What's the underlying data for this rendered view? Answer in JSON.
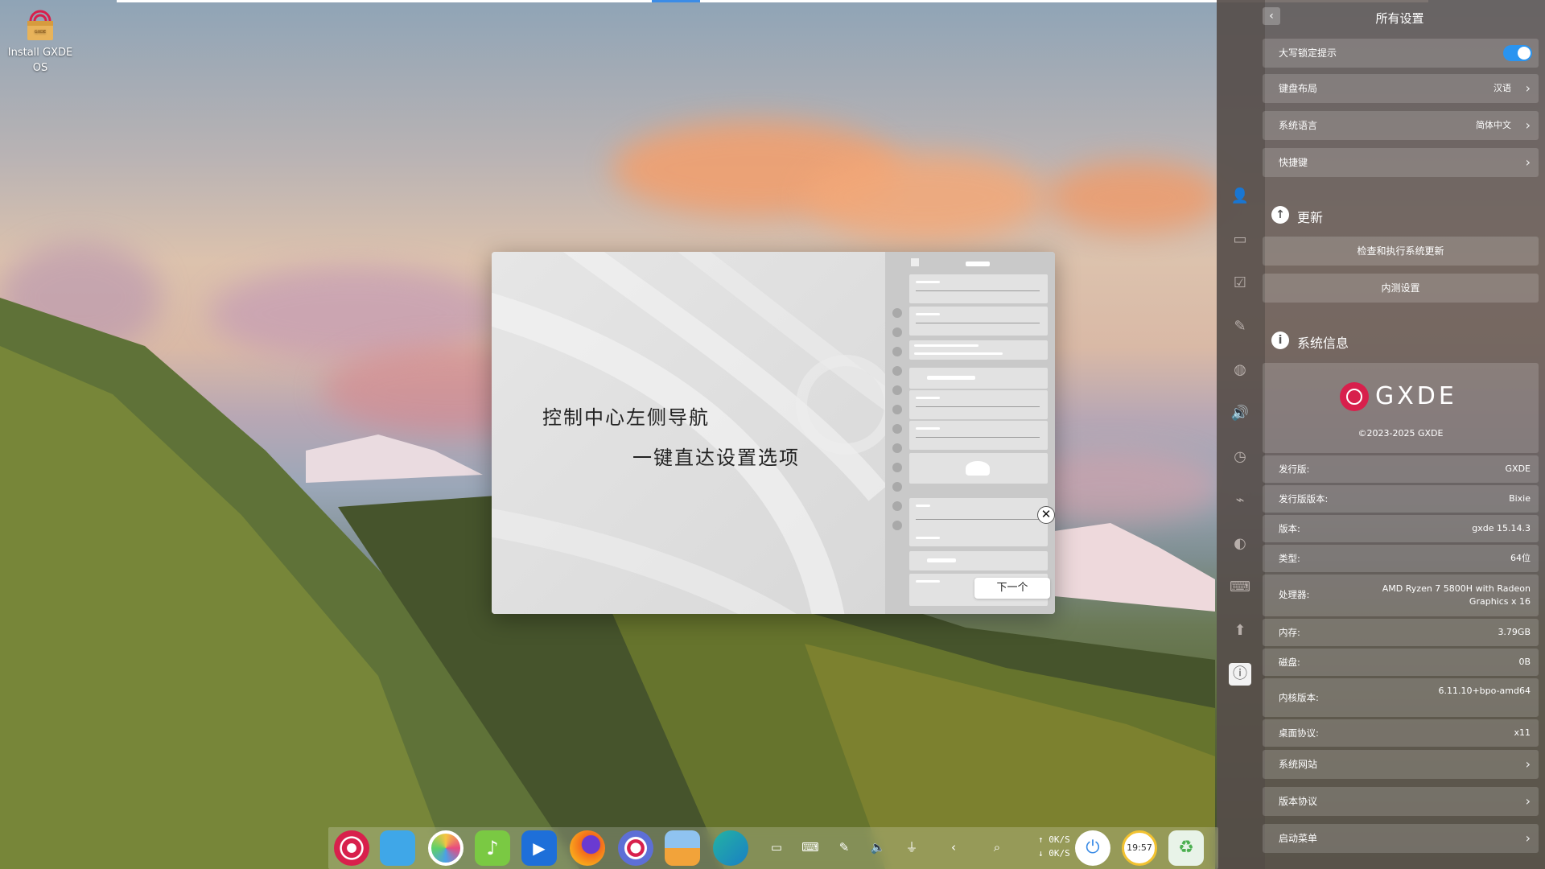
{
  "desktop": {
    "install_icon_label": "Install GXDE OS",
    "install_box_label": "GXDE"
  },
  "dialog": {
    "line1": "控制中心左侧导航",
    "line2": "一键直达设置选项",
    "next_label": "下一个",
    "close_glyph": "✕"
  },
  "settings": {
    "title": "所有设置",
    "back_glyph": "‹",
    "rows": {
      "caps_lock": "大写锁定提示",
      "keyboard_layout": "键盘布局",
      "keyboard_layout_value": "汉语",
      "system_language": "系统语言",
      "system_language_value": "简体中文",
      "shortcuts": "快捷键"
    },
    "update": {
      "title": "更新",
      "check_label": "检查和执行系统更新",
      "beta_label": "内测设置"
    },
    "system_info": {
      "title": "系统信息",
      "logo_text": "GXDE",
      "copyright": "©2023-2025 GXDE",
      "items": [
        {
          "label": "发行版:",
          "value": "GXDE"
        },
        {
          "label": "发行版版本:",
          "value": "Bixie"
        },
        {
          "label": "版本:",
          "value": "gxde 15.14.3"
        },
        {
          "label": "类型:",
          "value": "64位"
        },
        {
          "label": "处理器:",
          "value": "AMD Ryzen 7 5800H with Radeon Graphics x 16"
        },
        {
          "label": "内存:",
          "value": "3.79GB"
        },
        {
          "label": "磁盘:",
          "value": "0B"
        },
        {
          "label": "内核版本:",
          "value": "6.11.10+bpo-amd64"
        },
        {
          "label": "桌面协议:",
          "value": "x11"
        }
      ],
      "website": "系统网站",
      "license": "版本协议",
      "boot_menu": "启动菜单"
    }
  },
  "taskbar": {
    "net_up": "↑ 0K/S",
    "net_down": "↓ 0K/S",
    "clock": "19:57"
  },
  "colors": {
    "accent": "#2a94f0",
    "brand": "#d8204c"
  }
}
